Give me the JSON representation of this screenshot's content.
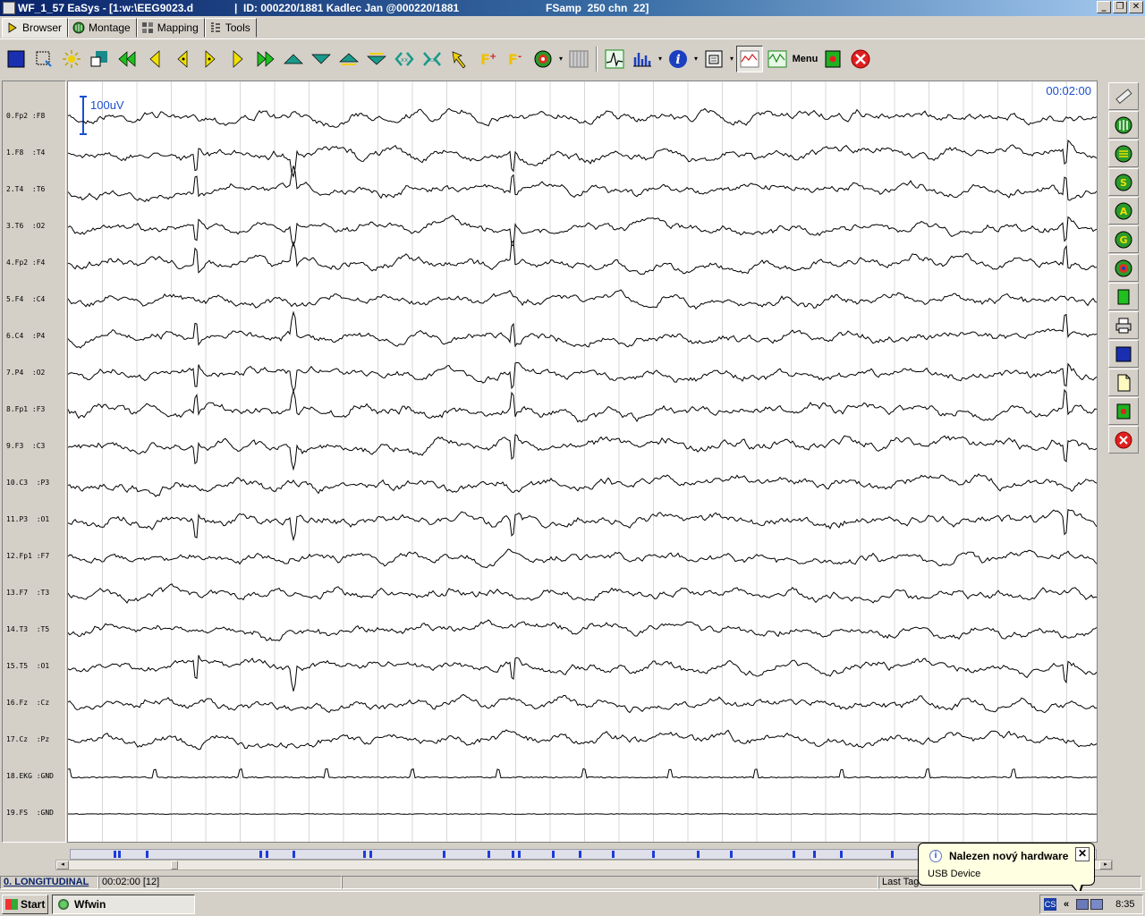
{
  "window": {
    "title_app": "WF_1_57 EaSys - [1:w:\\EEG9023.d",
    "title_id": "|  ID: 000220/1881 Kadlec Jan @000220/1881",
    "title_fs": "FSamp  250 chn  22]",
    "minimize": "_",
    "restore": "❐",
    "close": "✕"
  },
  "tabs": [
    {
      "label": "Browser",
      "active": true
    },
    {
      "label": "Montage",
      "active": false
    },
    {
      "label": "Mapping",
      "active": false
    },
    {
      "label": "Tools",
      "active": false
    }
  ],
  "toolbar": {
    "menu_label": "Menu",
    "icons": [
      "channels-icon",
      "select-icon",
      "brightness-icon",
      "color-icon",
      "fast-rewind-icon",
      "step-back-icon",
      "page-back-icon",
      "page-forward-icon",
      "step-forward-icon",
      "fast-forward-icon",
      "scale-up-icon",
      "scale-down-icon",
      "amplitude-up-icon",
      "amplitude-down-icon",
      "compress-time-icon",
      "expand-time-icon",
      "pointer-icon",
      "filter-plus-icon",
      "filter-minus-icon",
      "video-icon",
      "grid-icon",
      "spike-icon",
      "histogram-icon",
      "info-icon",
      "print-setup-icon",
      "waveform-view-icon",
      "overlay-view-icon",
      "record-icon",
      "exit-icon"
    ]
  },
  "eeg": {
    "timestamp": "00:02:00",
    "scale_label": "100uV",
    "channels": [
      "0.Fp2 :F8",
      "1.F8  :T4",
      "2.T4  :T6",
      "3.T6  :O2",
      "4.Fp2 :F4",
      "5.F4  :C4",
      "6.C4  :P4",
      "7.P4  :O2",
      "8.Fp1 :F3",
      "9.F3  :C3",
      "10.C3  :P3",
      "11.P3  :O1",
      "12.Fp1 :F7",
      "13.F7  :T3",
      "14.T3  :T5",
      "15.T5  :O1",
      "16.Fz  :Cz",
      "17.Cz  :Pz",
      "18.EKG :GND",
      "19.FS  :GND"
    ]
  },
  "status": {
    "montage": "0. LONGITUDINAL",
    "time": "00:02:00 [12]",
    "last_tag": "Last Tag"
  },
  "balloon": {
    "title": "Nalezen nový hardware",
    "body": "USB Device",
    "close": "✕"
  },
  "taskbar": {
    "start": "Start",
    "task": "Wfwin",
    "lang": "CS",
    "chevron": "«",
    "clock": "8:35"
  },
  "colors": {
    "accent_blue": "#1a4fd0",
    "marker_blue": "#1c3cd8",
    "panel": "#d4d0c8"
  }
}
